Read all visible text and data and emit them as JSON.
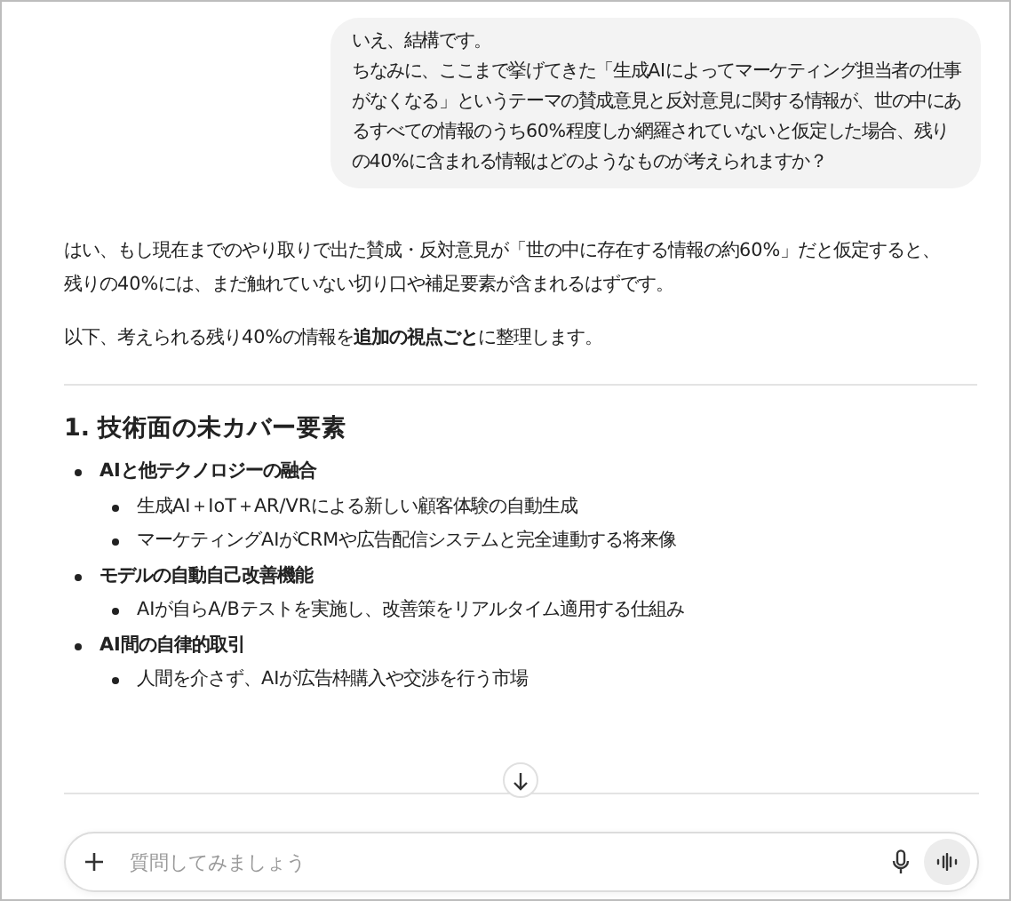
{
  "user_message": {
    "lines": [
      "いえ、結構です。",
      "ちなみに、ここまで挙げてきた「生成AIによってマーケティング担当者の仕事がなくなる」というテーマの賛成意見と反対意見に関する情報が、世の中にあるすべての情報のうち60%程度しか網羅されていないと仮定した場合、残りの40%に含まれる情報はどのようなものが考えられますか？"
    ]
  },
  "response": {
    "lines": [
      "はい、もし現在までのやり取りで出た賛成・反対意見が「世の中に存在する情報の約60%」だと仮定すると、",
      "残りの40%には、まだ触れていない切り口や補足要素が含まれるはずです。"
    ],
    "intro": "以下、考えられる残り40%の情報を**追加の視点ごと**に整理します。",
    "section": {
      "heading": "1. 技術面の未カバー要素",
      "items": [
        {
          "text": "AIと他テクノロジーの融合",
          "children": [
            {
              "text": "生成AI＋IoT＋AR/VRによる新しい顧客体験の自動生成"
            },
            {
              "text": "マーケティングAIがCRMや広告配信システムと完全連動する将来像"
            }
          ]
        },
        {
          "text": "モデルの自動自己改善機能",
          "children": [
            {
              "text": "AIが自らA/Bテストを実施し、改善策をリアルタイム適用する仕組み"
            }
          ]
        },
        {
          "text": "AI間の自律的取引",
          "children": [
            {
              "text": "人間を介さず、AIが広告枠購入や交渉を行う市場"
            }
          ]
        }
      ]
    }
  },
  "composer": {
    "placeholder": "質問してみましょう"
  }
}
